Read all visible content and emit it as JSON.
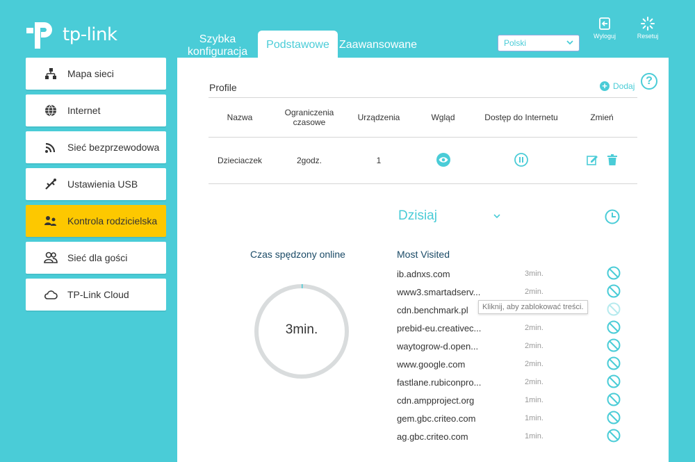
{
  "brand": {
    "name": "tp-link"
  },
  "tabs": {
    "quick": "Szybka konfiguracja",
    "basic": "Podstawowe",
    "advanced": "Zaawansowane"
  },
  "language": {
    "selected": "Polski"
  },
  "top_actions": {
    "logout": "Wyloguj",
    "reset": "Resetuj"
  },
  "sidebar": {
    "items": [
      {
        "label": "Mapa sieci",
        "icon": "network-map-icon"
      },
      {
        "label": "Internet",
        "icon": "globe-icon"
      },
      {
        "label": "Sieć bezprzewodowa",
        "icon": "wifi-icon"
      },
      {
        "label": "Ustawienia USB",
        "icon": "usb-icon"
      },
      {
        "label": "Kontrola rodzicielska",
        "icon": "family-icon",
        "active": true
      },
      {
        "label": "Sieć dla gości",
        "icon": "guests-icon"
      },
      {
        "label": "TP-Link Cloud",
        "icon": "cloud-icon"
      }
    ]
  },
  "profiles": {
    "title": "Profile",
    "add_label": "Dodaj",
    "columns": [
      "Nazwa",
      "Ograniczenia czasowe",
      "Urządzenia",
      "Wgląd",
      "Dostęp do Internetu",
      "Zmień"
    ],
    "rows": [
      {
        "name": "Dzieciaczek",
        "time_limit": "2godz.",
        "devices": "1"
      }
    ]
  },
  "insights": {
    "period": "Dzisiaj",
    "time_online_label": "Czas spędzony online",
    "time_online_value": "3min.",
    "most_visited_title": "Most Visited",
    "tooltip": "Kliknij, aby zablokować treści.",
    "sites": [
      {
        "name": "ib.adnxs.com",
        "time": "3min."
      },
      {
        "name": "www3.smartadserv...",
        "time": "2min."
      },
      {
        "name": "cdn.benchmark.pl",
        "time": ""
      },
      {
        "name": "prebid-eu.creativec...",
        "time": "2min."
      },
      {
        "name": "waytogrow-d.open...",
        "time": "2min."
      },
      {
        "name": "www.google.com",
        "time": "2min."
      },
      {
        "name": "fastlane.rubiconpro...",
        "time": "2min."
      },
      {
        "name": "cdn.ampproject.org",
        "time": "1min."
      },
      {
        "name": "gem.gbc.criteo.com",
        "time": "1min."
      },
      {
        "name": "ag.gbc.criteo.com",
        "time": "1min."
      }
    ]
  },
  "colors": {
    "accent": "#4accd7",
    "active": "#fdc800"
  }
}
